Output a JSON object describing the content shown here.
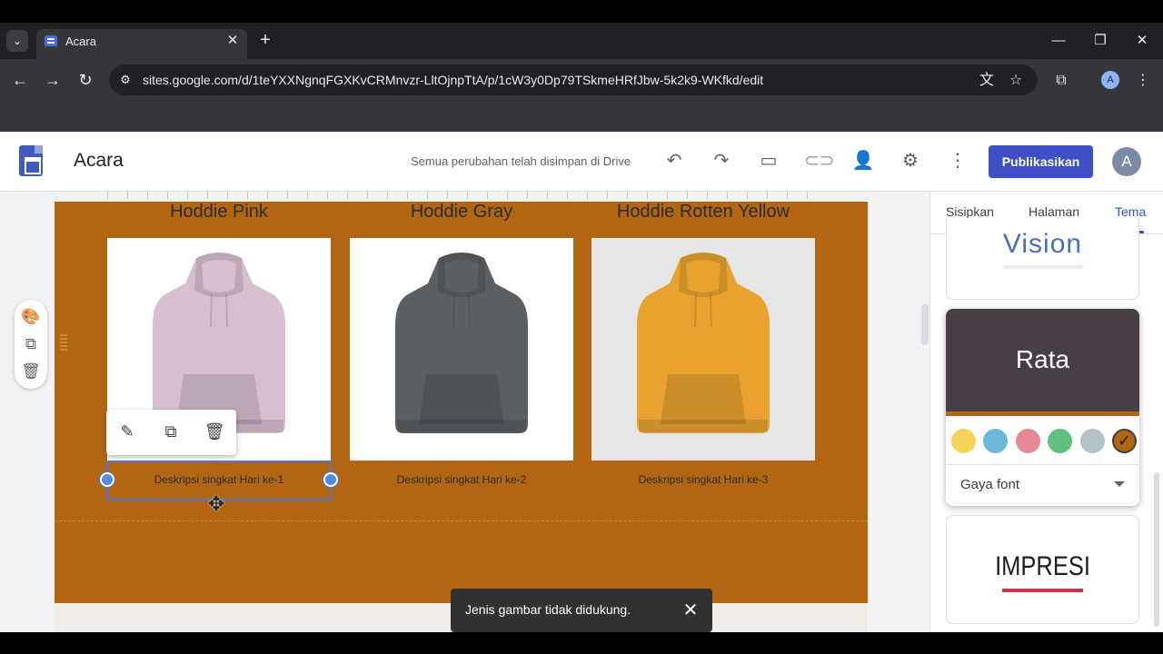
{
  "browser": {
    "tab_title": "Acara",
    "url": "sites.google.com/d/1teYXXNgnqFGXKvCRMnvzr-LltOjnpTtA/p/1cW3y0Dp79TSkmeHRfJbw-5k2k9-WKfkd/edit",
    "profile_initial": "A",
    "new_tab_label": "+",
    "close_label": "✕"
  },
  "header": {
    "site_title": "Acara",
    "save_status": "Semua perubahan telah disimpan di Drive",
    "publish_label": "Publikasikan",
    "avatar_initial": "A"
  },
  "products": [
    {
      "title": "Hoddie Pink",
      "description": "Deskripsi singkat Hari ke-1",
      "color": "#d8bfd0"
    },
    {
      "title": "Hoddie Gray",
      "description": "Deskripsi singkat Hari ke-2",
      "color": "#5c5f62"
    },
    {
      "title": "Hoddie Rotten Yellow",
      "description": "Deskripsi singkat Hari ke-3",
      "color": "#e9a22f"
    }
  ],
  "toast": {
    "message": "Jenis gambar tidak didukung.",
    "close_label": "✕"
  },
  "panel": {
    "tabs": [
      {
        "label": "Sisipkan",
        "active": false
      },
      {
        "label": "Halaman",
        "active": false
      },
      {
        "label": "Tema",
        "active": true
      }
    ],
    "themes": {
      "vision": "Vision",
      "rata": "Rata",
      "impresi": "IMPRESI"
    },
    "font_style_label": "Gaya font",
    "swatches": [
      "#f7d35a",
      "#6cb9dc",
      "#e58a94",
      "#5ec07c",
      "#b3c2c9",
      "#b26612"
    ],
    "selected_swatch": 5
  },
  "colors": {
    "section_bg": "#b26612",
    "accent": "#3c4fc6"
  }
}
